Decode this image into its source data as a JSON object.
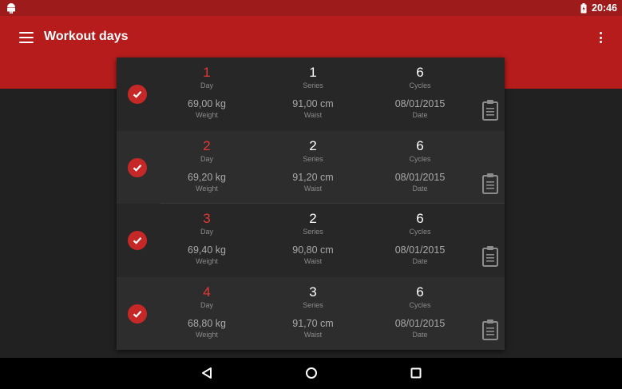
{
  "status": {
    "time": "20:46"
  },
  "app_bar": {
    "title": "Workout days"
  },
  "rows": [
    {
      "day": "1",
      "day_label": "Day",
      "series": "1",
      "series_label": "Series",
      "cycles": "6",
      "cycles_label": "Cycles",
      "weight": "69,00 kg",
      "weight_label": "Weight",
      "waist": "91,00 cm",
      "waist_label": "Waist",
      "date": "08/01/2015",
      "date_label": "Date"
    },
    {
      "day": "2",
      "day_label": "Day",
      "series": "2",
      "series_label": "Series",
      "cycles": "6",
      "cycles_label": "Cycles",
      "weight": "69,20 kg",
      "weight_label": "Weight",
      "waist": "91,20 cm",
      "waist_label": "Waist",
      "date": "08/01/2015",
      "date_label": "Date"
    },
    {
      "day": "3",
      "day_label": "Day",
      "series": "2",
      "series_label": "Series",
      "cycles": "6",
      "cycles_label": "Cycles",
      "weight": "69,40 kg",
      "weight_label": "Weight",
      "waist": "90,80 cm",
      "waist_label": "Waist",
      "date": "08/01/2015",
      "date_label": "Date"
    },
    {
      "day": "4",
      "day_label": "Day",
      "series": "3",
      "series_label": "Series",
      "cycles": "6",
      "cycles_label": "Cycles",
      "weight": "68,80 kg",
      "weight_label": "Weight",
      "waist": "91,70 cm",
      "waist_label": "Waist",
      "date": "08/01/2015",
      "date_label": "Date"
    }
  ],
  "colors": {
    "accent": "#b71c1c",
    "status_bar": "#9e1b1b",
    "day_number": "#e53935",
    "check_circle": "#c62828"
  },
  "icons": [
    "android-icon",
    "battery-icon",
    "menu-icon",
    "more-vert-icon",
    "check-icon",
    "clipboard-icon",
    "back-icon",
    "home-icon",
    "recents-icon"
  ]
}
